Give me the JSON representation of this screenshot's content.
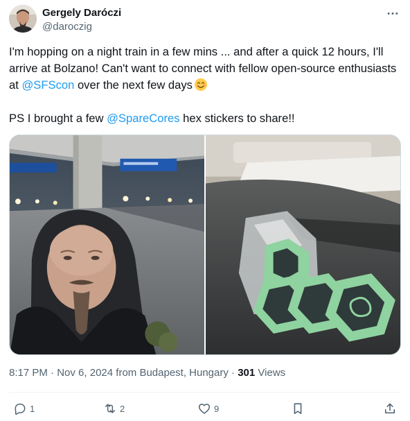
{
  "author": {
    "name": "Gergely Daróczi",
    "handle": "@daroczig"
  },
  "tweet": {
    "line1_before": "I'm hopping on a night train in a few mins ... and after a quick 12 hours, I'll arrive at Bolzano! Can't want to connect with fellow open-source enthusiasts at ",
    "mention1": "@SFScon",
    "line1_after": " over the next few days",
    "line2_before": "PS I brought a few ",
    "mention2": "@SpareCores",
    "line2_after": " hex stickers to share!!"
  },
  "meta": {
    "time": "8:17 PM",
    "date": "Nov 6, 2024",
    "from": "from Budapest, Hungary",
    "views_count": "301",
    "views_label": "Views"
  },
  "actions": {
    "replies": "1",
    "reposts": "2",
    "likes": "9"
  },
  "colors": {
    "link": "#1d9bf0",
    "text": "#0f1419",
    "muted": "#536471",
    "border": "#cfd9de",
    "sticker": "#8fd3a0"
  },
  "icons": [
    "more-icon",
    "reply-icon",
    "repost-icon",
    "like-icon",
    "bookmark-icon",
    "share-icon",
    "smiling-emoji"
  ]
}
